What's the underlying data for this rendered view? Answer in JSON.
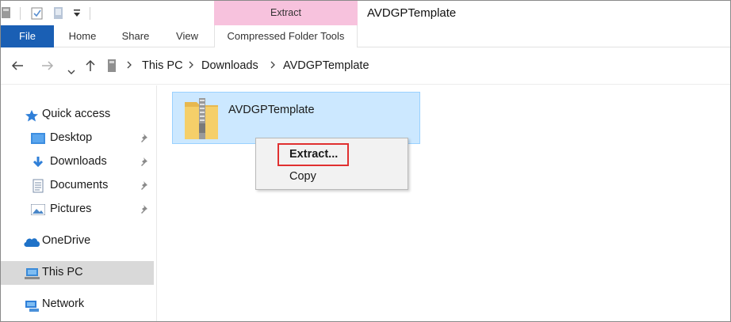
{
  "window": {
    "title": "AVDGPTemplate",
    "context_tab_group": "Extract"
  },
  "ribbon": {
    "tabs": [
      {
        "label": "File",
        "active": true
      },
      {
        "label": "Home"
      },
      {
        "label": "Share"
      },
      {
        "label": "View"
      },
      {
        "label": "Compressed Folder Tools"
      }
    ]
  },
  "address_bar": {
    "breadcrumb": [
      "This PC",
      "Downloads",
      "AVDGPTemplate"
    ]
  },
  "sidebar": {
    "items": [
      {
        "label": "Quick access",
        "icon": "star-icon"
      },
      {
        "label": "Desktop",
        "icon": "desktop-icon",
        "pinned": true
      },
      {
        "label": "Downloads",
        "icon": "download-icon",
        "pinned": true
      },
      {
        "label": "Documents",
        "icon": "documents-icon",
        "pinned": true
      },
      {
        "label": "Pictures",
        "icon": "pictures-icon",
        "pinned": true
      },
      {
        "label": "OneDrive",
        "icon": "cloud-icon"
      },
      {
        "label": "This PC",
        "icon": "computer-icon",
        "selected": true
      },
      {
        "label": "Network",
        "icon": "network-icon"
      }
    ]
  },
  "content": {
    "selected_item": {
      "name": "AVDGPTemplate",
      "icon": "zip-folder-icon"
    }
  },
  "context_menu": {
    "items": [
      {
        "label": "Extract...",
        "bold": true,
        "highlighted": true
      },
      {
        "label": "Copy"
      }
    ]
  },
  "colors": {
    "file_tab": "#1a5fb4",
    "context_tab_header": "#f7c2dd",
    "selection": "#cce8ff",
    "highlight_box": "#e03030"
  }
}
